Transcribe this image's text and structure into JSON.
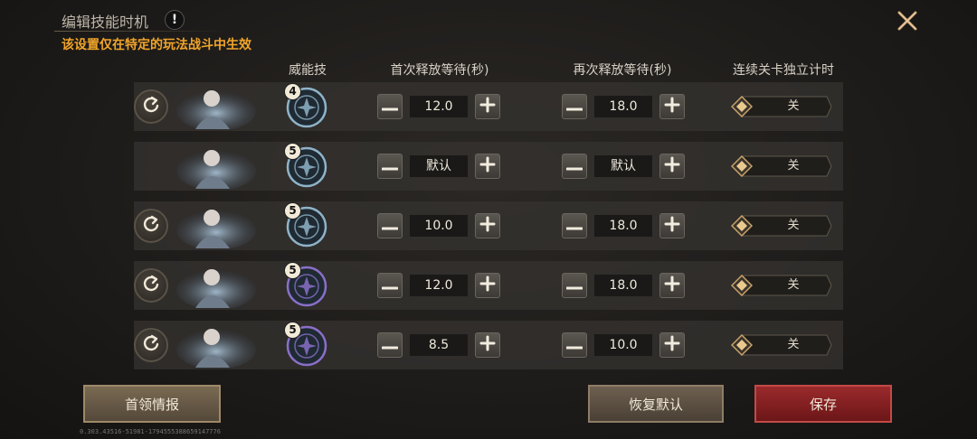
{
  "header": {
    "title": "编辑技能时机",
    "info_glyph": "!",
    "subtitle": "该设置仅在特定的玩法战斗中生效"
  },
  "columns": {
    "skill": "威能技",
    "first_wait": "首次释放等待(秒)",
    "next_wait": "再次释放等待(秒)",
    "independent_timer": "连续关卡独立计时"
  },
  "rows": [
    {
      "has_reset": true,
      "level": "4",
      "skill_color": "#8fb3c8",
      "first": "12.0",
      "next": "18.0",
      "toggle": "关"
    },
    {
      "has_reset": false,
      "level": "5",
      "skill_color": "#8fb3c8",
      "first": "默认",
      "next": "默认",
      "toggle": "关"
    },
    {
      "has_reset": true,
      "level": "5",
      "skill_color": "#8fb3c8",
      "first": "10.0",
      "next": "18.0",
      "toggle": "关"
    },
    {
      "has_reset": true,
      "level": "5",
      "skill_color": "#8a6fc8",
      "first": "12.0",
      "next": "18.0",
      "toggle": "关"
    },
    {
      "has_reset": true,
      "level": "5",
      "skill_color": "#8a6fc8",
      "first": "8.5",
      "next": "10.0",
      "toggle": "关"
    }
  ],
  "buttons": {
    "boss_info": "首领情报",
    "restore_default": "恢复默认",
    "save": "保存"
  },
  "version": "0.303.43516-51981-1794555388659147776",
  "colors": {
    "accent": "#f2a52a",
    "save": "#9a2a2c"
  }
}
